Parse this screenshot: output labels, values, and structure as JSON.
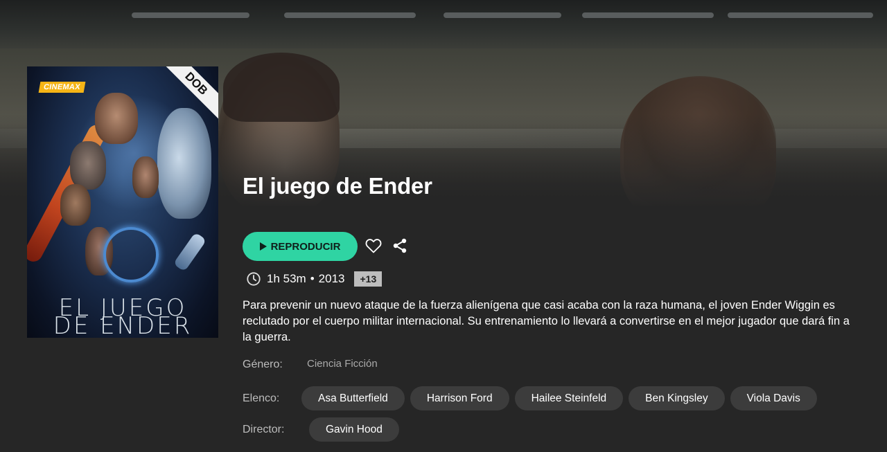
{
  "poster": {
    "brand": "CINEMAX",
    "badge": "DOB",
    "title_line1": "EL JUEGO",
    "title_line2": "DE ENDER"
  },
  "movie": {
    "title": "El juego de Ender",
    "duration": "1h 53m",
    "separator": "•",
    "year": "2013",
    "rating": "+13",
    "synopsis": "Para prevenir un nuevo ataque de la fuerza alienígena que casi acaba con la raza humana, el joven Ender Wiggin es reclutado por el cuerpo militar internacional. Su entrenamiento lo llevará a convertirse en el mejor jugador que dará fin a la guerra."
  },
  "actions": {
    "play_label": "REPRODUCIR",
    "favorite_icon": "heart-icon",
    "share_icon": "share-icon"
  },
  "details": {
    "genre_label": "Género:",
    "genre_value": "Ciencia Ficción",
    "cast_label": "Elenco:",
    "cast": [
      "Asa Butterfield",
      "Harrison Ford",
      "Hailee Steinfeld",
      "Ben Kingsley",
      "Viola Davis"
    ],
    "director_label": "Director:",
    "directors": [
      "Gavin Hood"
    ]
  },
  "colors": {
    "accent": "#2fd4a3",
    "background": "#262626",
    "chip": "#3c3c3c"
  }
}
